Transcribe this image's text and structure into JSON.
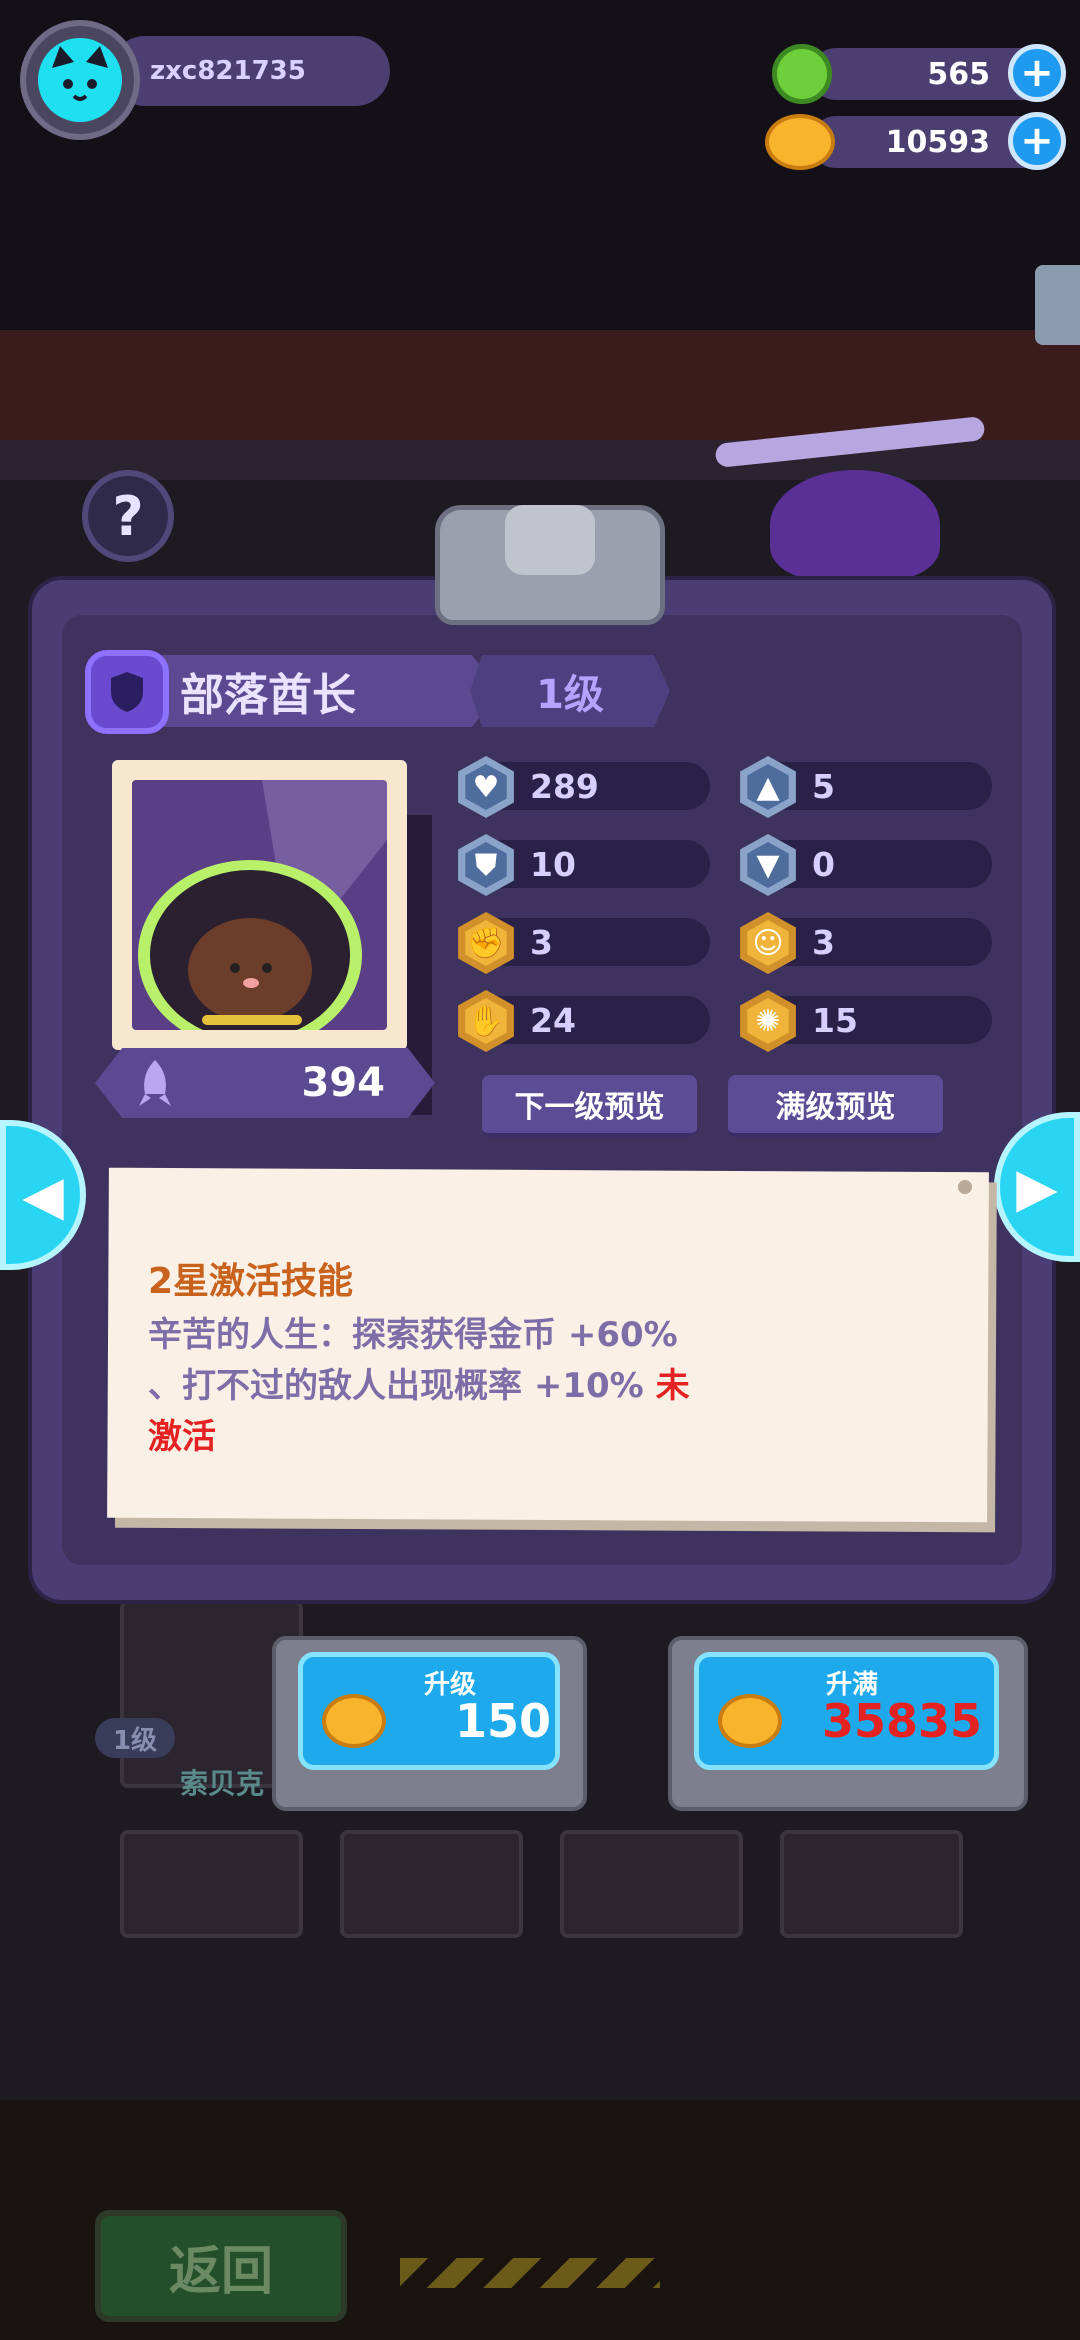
{
  "header": {
    "username": "zxc821735",
    "gem_currency": "565",
    "gold_currency": "10593",
    "plus_label": "+"
  },
  "help_label": "?",
  "hero": {
    "name": "部落酋长",
    "level": "1级",
    "power": "394"
  },
  "stats": [
    {
      "icon": "heart-icon",
      "value": "289"
    },
    {
      "icon": "attack-icon",
      "value": "5"
    },
    {
      "icon": "shield-icon",
      "value": "10"
    },
    {
      "icon": "sword-down-icon",
      "value": "0"
    },
    {
      "icon": "muscle-flex-icon",
      "value": "3"
    },
    {
      "icon": "smile-icon",
      "value": "3"
    },
    {
      "icon": "arm-icon",
      "value": "24"
    },
    {
      "icon": "brain-icon",
      "value": "15"
    }
  ],
  "buttons": {
    "next_level_preview": "下一级预览",
    "max_level_preview": "满级预览",
    "return": "返回"
  },
  "skill": {
    "title": "2星激活技能",
    "line1": "辛苦的人生：探索获得金币 +60%",
    "line2": "、打不过的敌人出现概率 +10%",
    "status_a": "未",
    "status_b": "激活"
  },
  "upgrade": {
    "label": "升级",
    "cost": "150"
  },
  "upgrade_max": {
    "label": "升满",
    "cost": "35835"
  },
  "background": {
    "card_level": "1级",
    "card_name": "索贝克"
  },
  "colors": {
    "panel": "#4a3d73",
    "cost_red": "#e52222",
    "button_blue": "#1da9ec",
    "accent_cyan": "#29d5f2"
  }
}
